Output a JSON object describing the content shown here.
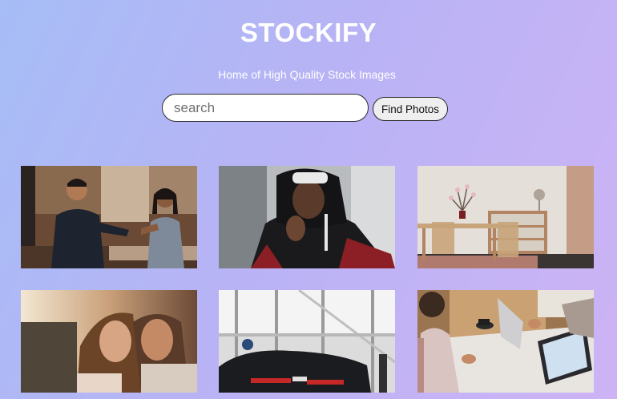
{
  "header": {
    "title": "STOCKIFY",
    "subtitle": "Home of High Quality Stock Images"
  },
  "search": {
    "placeholder": "search",
    "value": "",
    "button_label": "Find Photos"
  },
  "gallery": {
    "photos": [
      {
        "subject": "people-laughing-cafe"
      },
      {
        "subject": "man-in-hoodie"
      },
      {
        "subject": "dining-room-interior"
      },
      {
        "subject": "couple-embracing"
      },
      {
        "subject": "black-sports-car"
      },
      {
        "subject": "people-working-laptops"
      }
    ]
  },
  "colors": {
    "background_start": "#a6bdf6",
    "background_end": "#cdb3f5",
    "title_text": "#ffffff"
  }
}
